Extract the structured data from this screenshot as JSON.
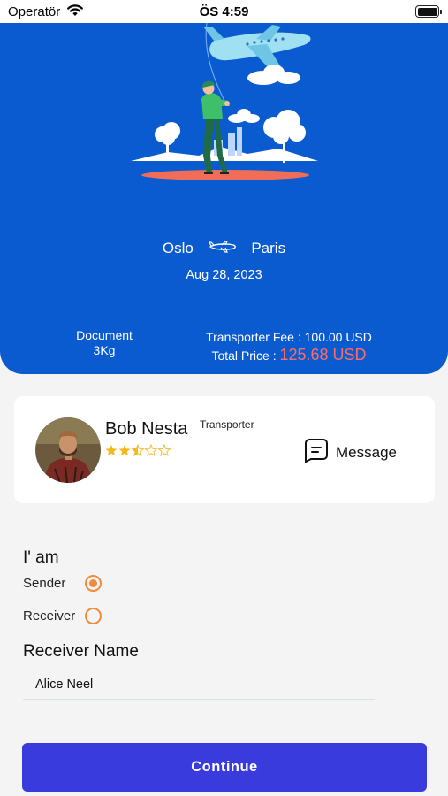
{
  "status_bar": {
    "carrier": "Operatör",
    "time": "ÖS 4:59"
  },
  "trip": {
    "origin": "Oslo",
    "destination": "Paris",
    "date": "Aug 28, 2023",
    "package_type": "Document",
    "package_weight": "3Kg",
    "transporter_fee": "Transporter Fee : 100.00 USD",
    "total_price_label": "Total Price :",
    "total_price_value": "125.68 USD"
  },
  "transporter": {
    "name": "Bob Nesta",
    "role": "Transporter",
    "rating": 2.5,
    "rating_max": 5,
    "message_label": "Message"
  },
  "form": {
    "role_title": "I' am",
    "options": [
      {
        "label": "Sender",
        "selected": true
      },
      {
        "label": "Receiver",
        "selected": false
      }
    ],
    "receiver_title": "Receiver Name",
    "receiver_value": "Alice Neel"
  },
  "actions": {
    "continue_label": "Continue"
  },
  "colors": {
    "primary_blue": "#0b5bd0",
    "accent_orange": "#f08a3c",
    "price_red": "#ff6b63",
    "button_indigo": "#3a3bdd",
    "star_gold": "#f3b81d"
  }
}
